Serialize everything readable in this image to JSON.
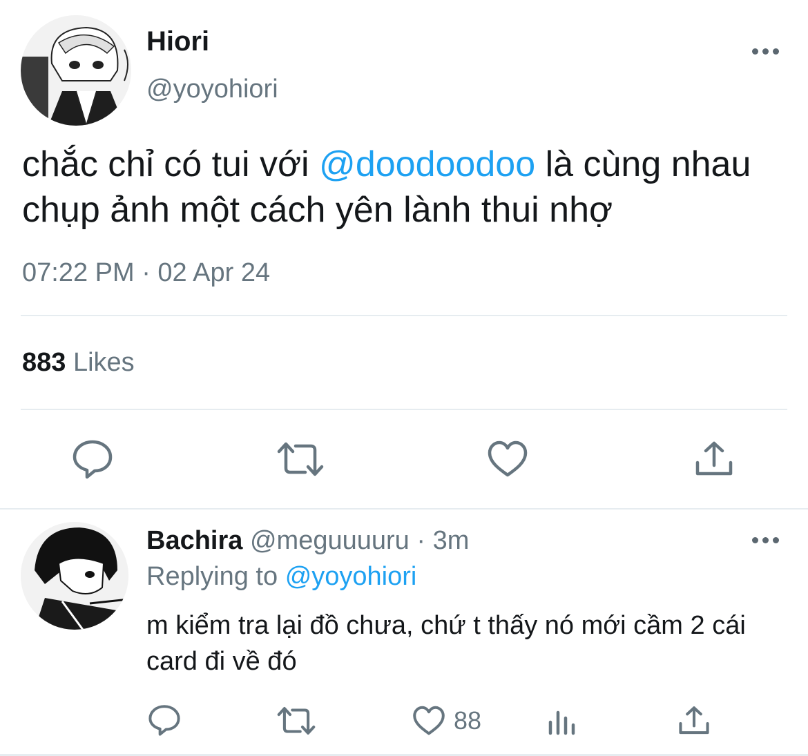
{
  "main_tweet": {
    "display_name": "Hiori",
    "handle": "@yoyohiori",
    "text_before": "chắc chỉ có tui với ",
    "mention": "@doodoodoo",
    "text_after": " là cùng nhau chụp ảnh một cách yên lành thui nhợ",
    "timestamp": "07:22 PM · 02 Apr 24",
    "likes_count": "883",
    "likes_label": "Likes",
    "actions": [
      "reply-icon",
      "retweet-icon",
      "like-icon",
      "share-icon"
    ]
  },
  "reply_tweet": {
    "display_name": "Bachira",
    "handle": "@meguuuuru",
    "time": "· 3m",
    "replying_label": "Replying to",
    "replying_to": "@yoyohiori",
    "text": "m kiểm tra lại đồ chưa, chứ t thấy nó mới cầm 2 cái card đi về đó",
    "like_count": "88",
    "actions": [
      "reply-icon",
      "retweet-icon",
      "like-icon",
      "analytics-icon",
      "share-icon"
    ]
  },
  "colors": {
    "accent": "#1da1f2",
    "secondary_text": "#66757f",
    "divider": "#e6ecf0"
  }
}
